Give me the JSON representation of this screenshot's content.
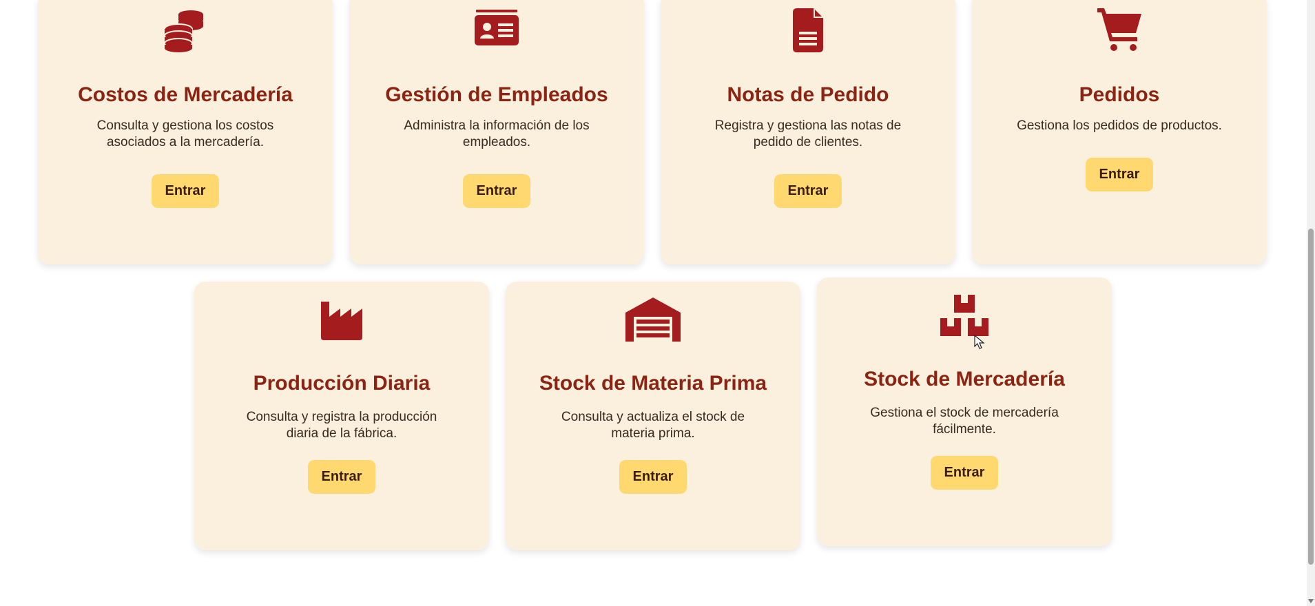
{
  "cards": [
    {
      "title": "Costos de Mercadería",
      "description": "Consulta y gestiona los costos asociados a la mercadería.",
      "button": "Entrar",
      "icon": "coins-icon"
    },
    {
      "title": "Gestión de Empleados",
      "description": "Administra la información de los empleados.",
      "button": "Entrar",
      "icon": "id-card-icon"
    },
    {
      "title": "Notas de Pedido",
      "description": "Registra y gestiona las notas de pedido de clientes.",
      "button": "Entrar",
      "icon": "file-icon"
    },
    {
      "title": "Pedidos",
      "description": "Gestiona los pedidos de productos.",
      "button": "Entrar",
      "icon": "cart-icon"
    },
    {
      "title": "Producción Diaria",
      "description": "Consulta y registra la producción diaria de la fábrica.",
      "button": "Entrar",
      "icon": "factory-icon"
    },
    {
      "title": "Stock de Materia Prima",
      "description": "Consulta y actualiza el stock de materia prima.",
      "button": "Entrar",
      "icon": "warehouse-icon"
    },
    {
      "title": "Stock de Mercadería",
      "description": "Gestiona el stock de mercadería fácilmente.",
      "button": "Entrar",
      "icon": "boxes-icon"
    }
  ],
  "colors": {
    "card_background": "#faf0dd",
    "icon": "#a51c1e",
    "title": "#8b2412",
    "button": "#ffd970"
  }
}
